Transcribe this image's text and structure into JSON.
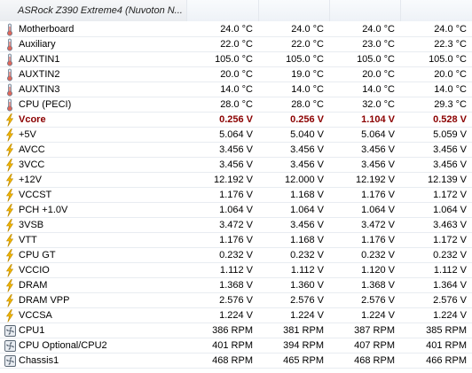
{
  "header": {
    "title": "ASRock Z390 Extreme4 (Nuvoton N..."
  },
  "rows": [
    {
      "icon": "thermometer-icon",
      "label": "Motherboard",
      "values": [
        "24.0 °C",
        "24.0 °C",
        "24.0 °C",
        "24.0 °C"
      ],
      "highlight": false
    },
    {
      "icon": "thermometer-icon",
      "label": "Auxiliary",
      "values": [
        "22.0 °C",
        "22.0 °C",
        "23.0 °C",
        "22.3 °C"
      ],
      "highlight": false
    },
    {
      "icon": "thermometer-icon",
      "label": "AUXTIN1",
      "values": [
        "105.0 °C",
        "105.0 °C",
        "105.0 °C",
        "105.0 °C"
      ],
      "highlight": false
    },
    {
      "icon": "thermometer-icon",
      "label": "AUXTIN2",
      "values": [
        "20.0 °C",
        "19.0 °C",
        "20.0 °C",
        "20.0 °C"
      ],
      "highlight": false
    },
    {
      "icon": "thermometer-icon",
      "label": "AUXTIN3",
      "values": [
        "14.0 °C",
        "14.0 °C",
        "14.0 °C",
        "14.0 °C"
      ],
      "highlight": false
    },
    {
      "icon": "thermometer-icon",
      "label": "CPU (PECI)",
      "values": [
        "28.0 °C",
        "28.0 °C",
        "32.0 °C",
        "29.3 °C"
      ],
      "highlight": false
    },
    {
      "icon": "lightning-icon",
      "label": "Vcore",
      "values": [
        "0.256 V",
        "0.256 V",
        "1.104 V",
        "0.528 V"
      ],
      "highlight": true
    },
    {
      "icon": "lightning-icon",
      "label": "+5V",
      "values": [
        "5.064 V",
        "5.040 V",
        "5.064 V",
        "5.059 V"
      ],
      "highlight": false
    },
    {
      "icon": "lightning-icon",
      "label": "AVCC",
      "values": [
        "3.456 V",
        "3.456 V",
        "3.456 V",
        "3.456 V"
      ],
      "highlight": false
    },
    {
      "icon": "lightning-icon",
      "label": "3VCC",
      "values": [
        "3.456 V",
        "3.456 V",
        "3.456 V",
        "3.456 V"
      ],
      "highlight": false
    },
    {
      "icon": "lightning-icon",
      "label": "+12V",
      "values": [
        "12.192 V",
        "12.000 V",
        "12.192 V",
        "12.139 V"
      ],
      "highlight": false
    },
    {
      "icon": "lightning-icon",
      "label": "VCCST",
      "values": [
        "1.176 V",
        "1.168 V",
        "1.176 V",
        "1.172 V"
      ],
      "highlight": false
    },
    {
      "icon": "lightning-icon",
      "label": "PCH +1.0V",
      "values": [
        "1.064 V",
        "1.064 V",
        "1.064 V",
        "1.064 V"
      ],
      "highlight": false
    },
    {
      "icon": "lightning-icon",
      "label": "3VSB",
      "values": [
        "3.472 V",
        "3.456 V",
        "3.472 V",
        "3.463 V"
      ],
      "highlight": false
    },
    {
      "icon": "lightning-icon",
      "label": "VTT",
      "values": [
        "1.176 V",
        "1.168 V",
        "1.176 V",
        "1.172 V"
      ],
      "highlight": false
    },
    {
      "icon": "lightning-icon",
      "label": "CPU GT",
      "values": [
        "0.232 V",
        "0.232 V",
        "0.232 V",
        "0.232 V"
      ],
      "highlight": false
    },
    {
      "icon": "lightning-icon",
      "label": "VCCIO",
      "values": [
        "1.112 V",
        "1.112 V",
        "1.120 V",
        "1.112 V"
      ],
      "highlight": false
    },
    {
      "icon": "lightning-icon",
      "label": "DRAM",
      "values": [
        "1.368 V",
        "1.360 V",
        "1.368 V",
        "1.364 V"
      ],
      "highlight": false
    },
    {
      "icon": "lightning-icon",
      "label": "DRAM VPP",
      "values": [
        "2.576 V",
        "2.576 V",
        "2.576 V",
        "2.576 V"
      ],
      "highlight": false
    },
    {
      "icon": "lightning-icon",
      "label": "VCCSA",
      "values": [
        "1.224 V",
        "1.224 V",
        "1.224 V",
        "1.224 V"
      ],
      "highlight": false
    },
    {
      "icon": "fan-icon",
      "label": "CPU1",
      "values": [
        "386 RPM",
        "381 RPM",
        "387 RPM",
        "385 RPM"
      ],
      "highlight": false
    },
    {
      "icon": "fan-icon",
      "label": "CPU Optional/CPU2",
      "values": [
        "401 RPM",
        "394 RPM",
        "407 RPM",
        "401 RPM"
      ],
      "highlight": false
    },
    {
      "icon": "fan-icon",
      "label": "Chassis1",
      "values": [
        "468 RPM",
        "465 RPM",
        "468 RPM",
        "466 RPM"
      ],
      "highlight": false
    }
  ],
  "colors": {
    "highlight_text": "#8b0000",
    "lightning": "#f2b600",
    "thermometer": "#6b7c8f",
    "fan": "#556270"
  }
}
